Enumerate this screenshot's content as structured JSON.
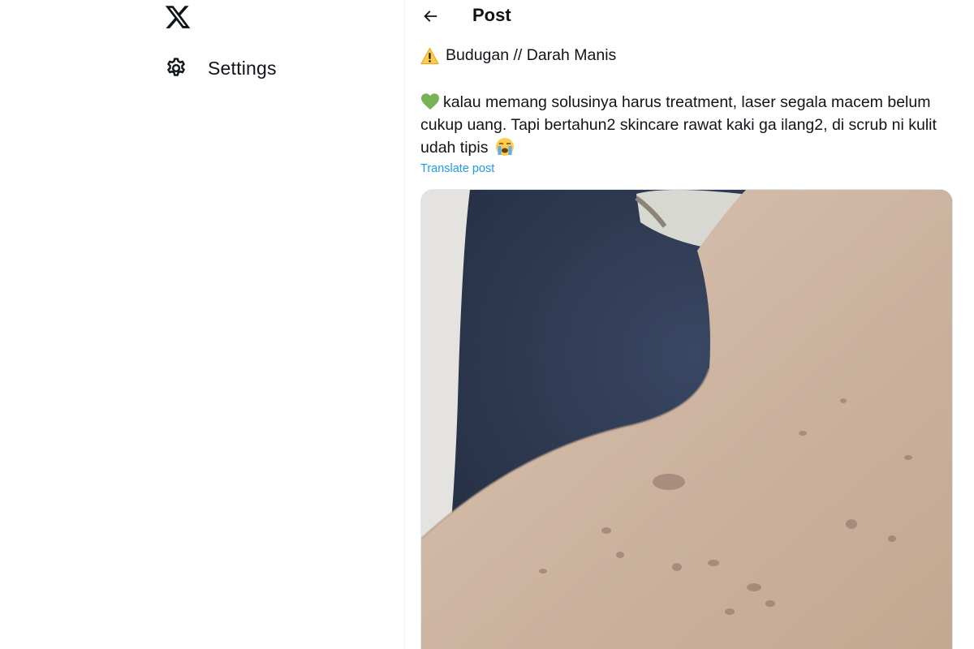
{
  "nav": {
    "items": [
      {
        "label": "Settings",
        "icon": "gear-icon"
      }
    ],
    "logo": "x-logo-icon"
  },
  "header": {
    "title": "Post",
    "back_icon": "back-arrow-icon"
  },
  "post": {
    "line1": "Budugan // Darah Manis",
    "line1_icon": "warning-icon",
    "body_icon": "green-heart-icon",
    "body": "kalau memang solusinya harus treatment, laser segala macem belum cukup uang. Tapi bertahun2 skincare rawat kaki ga ilang2, di scrub ni kulit udah tipis",
    "body_end_icon": "loudly-crying-face-icon",
    "translate_label": "Translate post",
    "media_icon": "photo-leg-skin-spots"
  },
  "colors": {
    "text": "#0f1419",
    "link": "#1d9bf0",
    "divider": "#eff3f4"
  }
}
